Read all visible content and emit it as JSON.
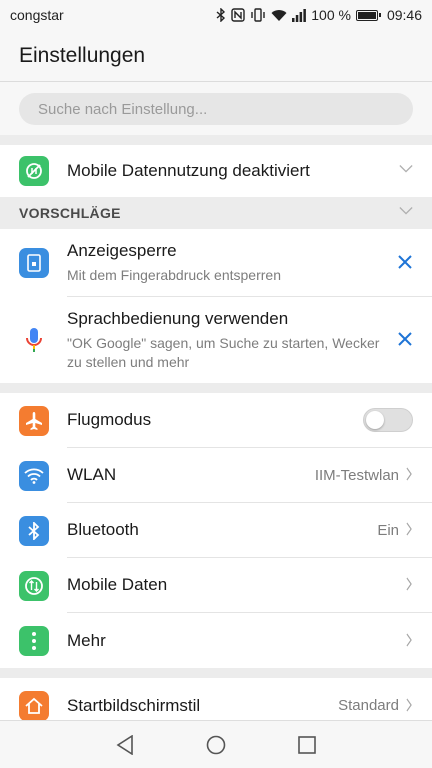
{
  "status_bar": {
    "carrier": "congstar",
    "battery_text": "100 %",
    "time": "09:46",
    "icons": [
      "bluetooth-icon",
      "nfc-icon",
      "vibrate-icon",
      "wifi-icon",
      "signal-icon",
      "battery-icon"
    ]
  },
  "header": {
    "title": "Einstellungen"
  },
  "search": {
    "placeholder": "Suche nach Einstellung..."
  },
  "data_usage": {
    "title": "Mobile Datennutzung deaktiviert",
    "icon": "data-off-icon"
  },
  "suggestions": {
    "heading": "VORSCHLÄGE",
    "items": [
      {
        "title": "Anzeigesperre",
        "subtitle": "Mit dem Fingerabdruck entsperren",
        "icon": "screen-lock-icon"
      },
      {
        "title": "Sprachbedienung verwenden",
        "subtitle": "\"OK Google\" sagen, um Suche zu starten, Wecker zu stellen und mehr",
        "icon": "microphone-icon"
      }
    ]
  },
  "network": {
    "items": [
      {
        "title": "Flugmodus",
        "icon": "airplane-icon",
        "toggle_on": false
      },
      {
        "title": "WLAN",
        "value": "IIM-Testwlan",
        "icon": "wifi-icon"
      },
      {
        "title": "Bluetooth",
        "value": "Ein",
        "icon": "bluetooth-icon"
      },
      {
        "title": "Mobile Daten",
        "icon": "mobile-data-icon"
      },
      {
        "title": "Mehr",
        "icon": "more-icon"
      }
    ]
  },
  "display": {
    "items": [
      {
        "title": "Startbildschirmstil",
        "value": "Standard",
        "icon": "home-icon"
      }
    ]
  },
  "navbar": {
    "icons": [
      "back-icon",
      "home-nav-icon",
      "recents-icon"
    ]
  },
  "colors": {
    "data_green": "#3cc26a",
    "blue_icon": "#3a8ee0",
    "orange": "#f47c30",
    "accent_blue": "#1e74d6"
  }
}
